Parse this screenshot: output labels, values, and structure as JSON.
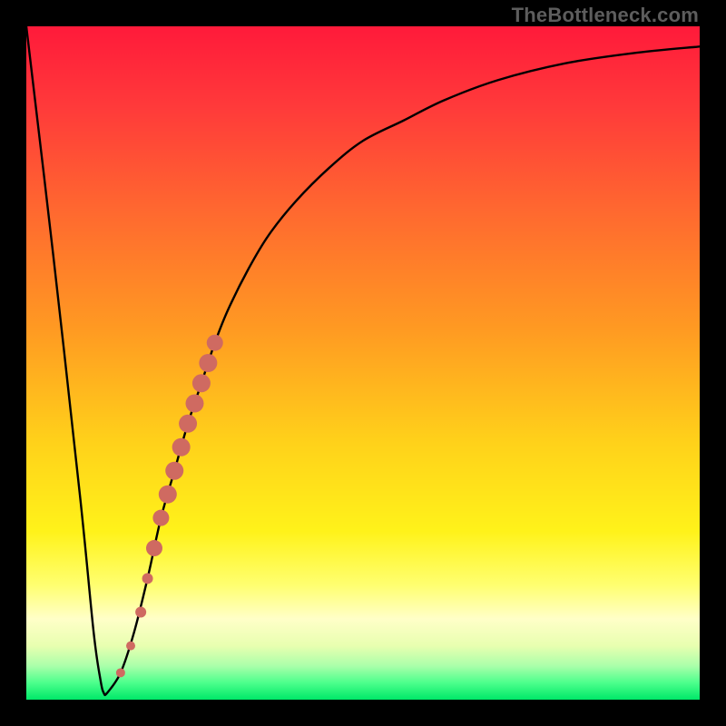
{
  "watermark": "TheBottleneck.com",
  "colors": {
    "frame": "#000000",
    "curve": "#000000",
    "marker_fill": "#cf6a61",
    "marker_stroke": "#a24b44",
    "gradient_stops": [
      {
        "offset": 0.0,
        "color": "#ff1a3a"
      },
      {
        "offset": 0.12,
        "color": "#ff3a3a"
      },
      {
        "offset": 0.28,
        "color": "#ff6a2f"
      },
      {
        "offset": 0.45,
        "color": "#ff9a22"
      },
      {
        "offset": 0.62,
        "color": "#ffd21a"
      },
      {
        "offset": 0.75,
        "color": "#fff21a"
      },
      {
        "offset": 0.83,
        "color": "#ffff70"
      },
      {
        "offset": 0.88,
        "color": "#ffffc8"
      },
      {
        "offset": 0.92,
        "color": "#e8ffb0"
      },
      {
        "offset": 0.95,
        "color": "#aaffaa"
      },
      {
        "offset": 0.975,
        "color": "#4cff8c"
      },
      {
        "offset": 1.0,
        "color": "#00e868"
      }
    ]
  },
  "chart_data": {
    "type": "line",
    "title": "",
    "xlabel": "",
    "ylabel": "",
    "xlim": [
      0,
      100
    ],
    "ylim": [
      0,
      100
    ],
    "series": [
      {
        "name": "bottleneck-curve",
        "x": [
          0,
          4,
          8,
          10,
          11,
          11.5,
          12,
          14,
          16,
          18,
          20,
          22,
          24,
          26,
          28,
          30,
          33,
          36,
          40,
          45,
          50,
          56,
          62,
          70,
          80,
          90,
          100
        ],
        "values": [
          100,
          66,
          30,
          10,
          3,
          1,
          1,
          4,
          10,
          18,
          27,
          34,
          41,
          47,
          53,
          58,
          64,
          69,
          74,
          79,
          83,
          86,
          89,
          92,
          94.5,
          96,
          97
        ]
      }
    ],
    "markers": {
      "name": "highlight-segment",
      "x": [
        14.0,
        15.5,
        17.0,
        18.0,
        19.0,
        20.0,
        21.0,
        22.0,
        23.0,
        24.0,
        25.0,
        26.0,
        27.0,
        28.0
      ],
      "values": [
        4.0,
        8.0,
        13.0,
        18.0,
        22.5,
        27.0,
        30.5,
        34.0,
        37.5,
        41.0,
        44.0,
        47.0,
        50.0,
        53.0
      ],
      "radius": [
        5,
        5,
        6,
        6,
        9,
        9,
        10,
        10,
        10,
        10,
        10,
        10,
        10,
        9
      ]
    }
  }
}
